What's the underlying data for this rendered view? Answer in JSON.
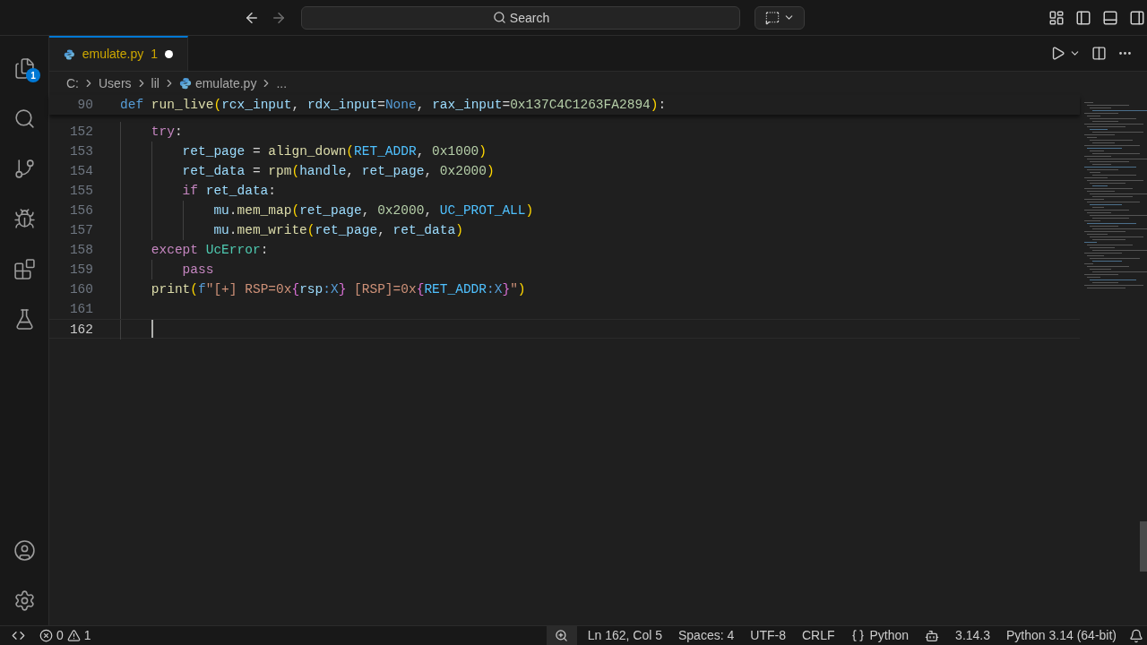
{
  "title_bar": {
    "search": {
      "placeholder": "Search"
    }
  },
  "activity_bar": {
    "items": [
      {
        "kind": "files",
        "selected": false,
        "badge": "1"
      },
      {
        "kind": "search",
        "selected": false
      },
      {
        "kind": "source-control",
        "selected": false
      },
      {
        "kind": "run-debug",
        "selected": false
      },
      {
        "kind": "extensions",
        "selected": false
      },
      {
        "kind": "testing",
        "selected": false
      }
    ],
    "bottom": [
      {
        "kind": "account"
      },
      {
        "kind": "settings"
      }
    ]
  },
  "tabs": [
    {
      "label": "emulate.py",
      "problems": "1",
      "modified": true,
      "selected": true
    }
  ],
  "breadcrumb": [
    "C:",
    "Users",
    "lil",
    "emulate.py",
    "..."
  ],
  "sticky": {
    "number": "90",
    "tokens": [
      {
        "kind": "def",
        "text": "def "
      },
      {
        "kind": "fn",
        "text": "run_live"
      },
      {
        "kind": "b1",
        "text": "("
      },
      {
        "kind": "var",
        "text": "rcx_input"
      },
      {
        "kind": "plain",
        "text": ", "
      },
      {
        "kind": "var",
        "text": "rdx_input"
      },
      {
        "kind": "plain",
        "text": "="
      },
      {
        "kind": "def",
        "text": "None"
      },
      {
        "kind": "plain",
        "text": ", "
      },
      {
        "kind": "var",
        "text": "rax_input"
      },
      {
        "kind": "plain",
        "text": "="
      },
      {
        "kind": "num",
        "text": "0x137C4C1263FA2894"
      },
      {
        "kind": "b1",
        "text": ")"
      },
      {
        "kind": "plain",
        "text": ":"
      }
    ]
  },
  "lines": [
    {
      "number": "152",
      "current": false,
      "tokens": [
        {
          "kind": "kw",
          "text": "try"
        },
        {
          "kind": "plain",
          "text": ":"
        }
      ],
      "children": [
        {
          "number": "153",
          "current": false,
          "tokens": [
            {
              "kind": "var",
              "text": "ret_page"
            },
            {
              "kind": "plain",
              "text": " = "
            },
            {
              "kind": "fn",
              "text": "align_down"
            },
            {
              "kind": "b1",
              "text": "("
            },
            {
              "kind": "const",
              "text": "RET_ADDR"
            },
            {
              "kind": "plain",
              "text": ", "
            },
            {
              "kind": "num",
              "text": "0x1000"
            },
            {
              "kind": "b1",
              "text": ")"
            }
          ]
        },
        {
          "number": "154",
          "current": false,
          "tokens": [
            {
              "kind": "var",
              "text": "ret_data"
            },
            {
              "kind": "plain",
              "text": " = "
            },
            {
              "kind": "fn",
              "text": "rpm"
            },
            {
              "kind": "b1",
              "text": "("
            },
            {
              "kind": "var",
              "text": "handle"
            },
            {
              "kind": "plain",
              "text": ", "
            },
            {
              "kind": "var",
              "text": "ret_page"
            },
            {
              "kind": "plain",
              "text": ", "
            },
            {
              "kind": "num",
              "text": "0x2000"
            },
            {
              "kind": "b1",
              "text": ")"
            }
          ]
        },
        {
          "number": "155",
          "current": false,
          "tokens": [
            {
              "kind": "kw",
              "text": "if "
            },
            {
              "kind": "var",
              "text": "ret_data"
            },
            {
              "kind": "plain",
              "text": ":"
            }
          ],
          "children": [
            {
              "number": "156",
              "current": false,
              "tokens": [
                {
                  "kind": "var",
                  "text": "mu"
                },
                {
                  "kind": "plain",
                  "text": "."
                },
                {
                  "kind": "fn",
                  "text": "mem_map"
                },
                {
                  "kind": "b1",
                  "text": "("
                },
                {
                  "kind": "var",
                  "text": "ret_page"
                },
                {
                  "kind": "plain",
                  "text": ", "
                },
                {
                  "kind": "num",
                  "text": "0x2000"
                },
                {
                  "kind": "plain",
                  "text": ", "
                },
                {
                  "kind": "const",
                  "text": "UC_PROT_ALL"
                },
                {
                  "kind": "b1",
                  "text": ")"
                }
              ]
            },
            {
              "number": "157",
              "current": false,
              "tokens": [
                {
                  "kind": "var",
                  "text": "mu"
                },
                {
                  "kind": "plain",
                  "text": "."
                },
                {
                  "kind": "fn",
                  "text": "mem_write"
                },
                {
                  "kind": "b1",
                  "text": "("
                },
                {
                  "kind": "var",
                  "text": "ret_page"
                },
                {
                  "kind": "plain",
                  "text": ", "
                },
                {
                  "kind": "var",
                  "text": "ret_data"
                },
                {
                  "kind": "b1",
                  "text": ")"
                }
              ]
            }
          ]
        }
      ]
    },
    {
      "number": "158",
      "current": false,
      "tokens": [
        {
          "kind": "kw",
          "text": "except "
        },
        {
          "kind": "cls",
          "text": "UcError"
        },
        {
          "kind": "plain",
          "text": ":"
        }
      ],
      "children": [
        {
          "number": "159",
          "current": false,
          "tokens": [
            {
              "kind": "kw",
              "text": "pass"
            }
          ]
        }
      ]
    },
    {
      "number": "160",
      "current": false,
      "tokens": [
        {
          "kind": "fn",
          "text": "print"
        },
        {
          "kind": "b1",
          "text": "("
        },
        {
          "kind": "def",
          "text": "f"
        },
        {
          "kind": "str",
          "text": "\"[+] RSP=0x"
        },
        {
          "kind": "b2",
          "text": "{"
        },
        {
          "kind": "var",
          "text": "rsp"
        },
        {
          "kind": "def",
          "text": ":X"
        },
        {
          "kind": "b2",
          "text": "}"
        },
        {
          "kind": "str",
          "text": " [RSP]=0x"
        },
        {
          "kind": "b2",
          "text": "{"
        },
        {
          "kind": "const",
          "text": "RET_ADDR"
        },
        {
          "kind": "def",
          "text": ":X"
        },
        {
          "kind": "b2",
          "text": "}"
        },
        {
          "kind": "str",
          "text": "\""
        },
        {
          "kind": "b1",
          "text": ")"
        }
      ]
    },
    {
      "number": "161",
      "current": false
    },
    {
      "number": "162",
      "current": true
    }
  ],
  "status_bar": {
    "errors": "0",
    "warnings": "1",
    "position": "Ln 162, Col 5",
    "spaces": "Spaces: 4",
    "encoding": "UTF-8",
    "eol": "CRLF",
    "language": "Python",
    "version": "3.14.3",
    "interpreter": "Python 3.14 (64-bit)"
  }
}
